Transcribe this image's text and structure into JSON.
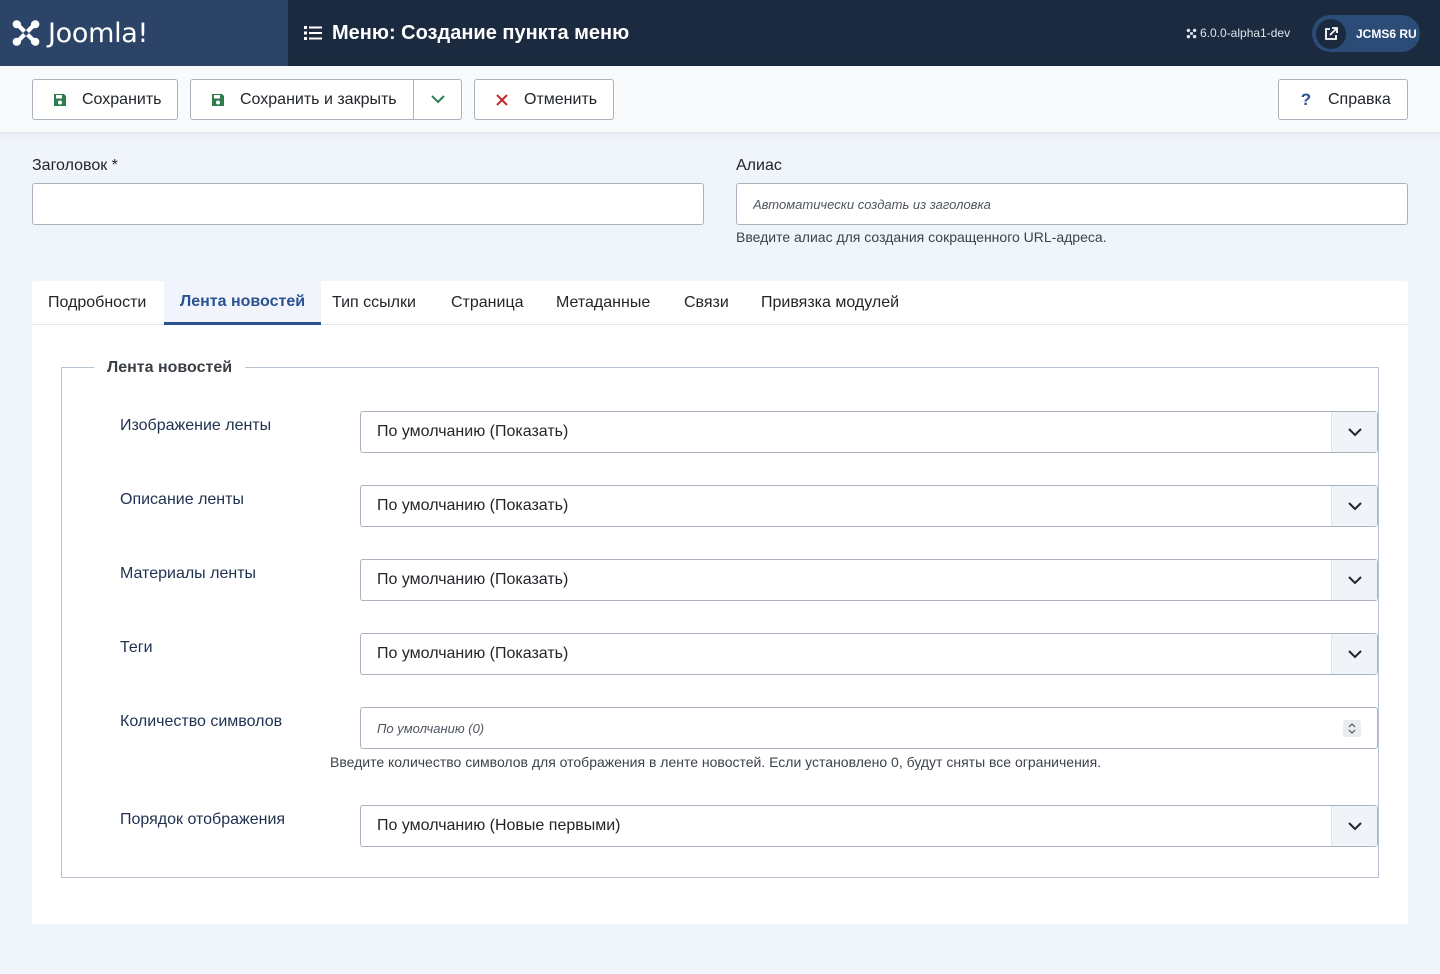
{
  "header": {
    "logo_text": "Joomla!",
    "title": "Меню: Создание пункта меню",
    "version": "6.0.0-alpha1-dev",
    "site_label": "JCMS6 RU"
  },
  "toolbar": {
    "save_label": "Сохранить",
    "save_close_label": "Сохранить и закрыть",
    "cancel_label": "Отменить",
    "help_label": "Справка"
  },
  "form": {
    "title_label": "Заголовок *",
    "title_value": "",
    "alias_label": "Алиас",
    "alias_placeholder": "Автоматически создать из заголовка",
    "alias_hint": "Введите алиас для создания сокращенного URL-адреса."
  },
  "tabs": [
    {
      "label": "Подробности",
      "active": false
    },
    {
      "label": "Лента новостей",
      "active": true
    },
    {
      "label": "Тип ссылки",
      "active": false
    },
    {
      "label": "Страница",
      "active": false
    },
    {
      "label": "Метаданные",
      "active": false
    },
    {
      "label": "Связи",
      "active": false
    },
    {
      "label": "Привязка модулей",
      "active": false
    }
  ],
  "feed": {
    "legend": "Лента новостей",
    "fields": [
      {
        "label": "Изображение ленты",
        "value": "По умолчанию (Показать)"
      },
      {
        "label": "Описание ленты",
        "value": "По умолчанию (Показать)"
      },
      {
        "label": "Материалы ленты",
        "value": "По умолчанию (Показать)"
      },
      {
        "label": "Теги",
        "value": "По умолчанию (Показать)"
      }
    ],
    "char_count": {
      "label": "Количество символов",
      "placeholder": "По умолчанию (0)",
      "hint": "Введите количество символов для отображения в ленте новостей. Если установлено 0, будут сняты все ограничения."
    },
    "order": {
      "label": "Порядок отображения",
      "value": "По умолчанию (Новые первыми)"
    }
  },
  "colors": {
    "header_bg": "#1c2a3f",
    "logo_bg": "#2c4468",
    "accent": "#2a5191",
    "save_icon": "#2f7d4f",
    "cancel_icon": "#c52827"
  }
}
